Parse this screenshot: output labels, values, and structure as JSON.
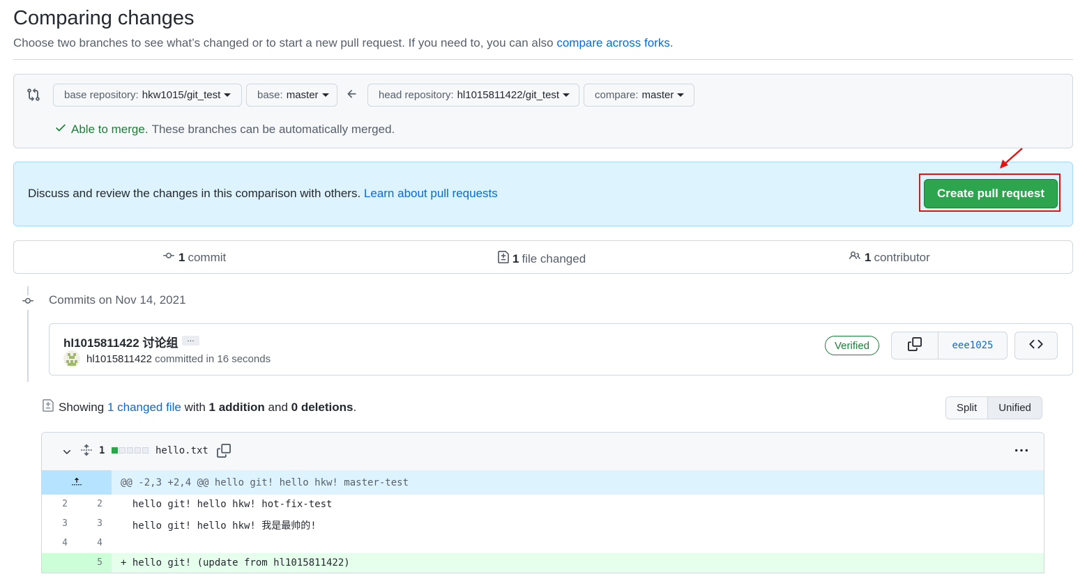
{
  "header": {
    "title": "Comparing changes",
    "subtitle": "Choose two branches to see what’s changed or to start a new pull request. If you need to, you can also ",
    "subtitle_link": "compare across forks",
    "subtitle_end": "."
  },
  "range": {
    "base_repo_label": "base repository:",
    "base_repo_value": "hkw1015/git_test",
    "base_label": "base:",
    "base_value": "master",
    "head_repo_label": "head repository:",
    "head_repo_value": "hl1015811422/git_test",
    "compare_label": "compare:",
    "compare_value": "master",
    "merge_ok": "Able to merge.",
    "merge_msg": "These branches can be automatically merged."
  },
  "discuss": {
    "text": "Discuss and review the changes in this comparison with others.",
    "link": "Learn about pull requests",
    "button": "Create pull request"
  },
  "summary": {
    "commits_count": "1",
    "commits_label": "commit",
    "files_count": "1",
    "files_label": "file changed",
    "contributors_count": "1",
    "contributors_label": "contributor"
  },
  "commits": {
    "date_heading": "Commits on Nov 14, 2021",
    "title": "hl1015811422 讨论组",
    "ellipsis": "…",
    "author": "hl1015811422",
    "meta": "committed in 16 seconds",
    "verified": "Verified",
    "sha": "eee1025"
  },
  "showing": {
    "prefix": "Showing",
    "changed_link": "1 changed file",
    "with": "with",
    "additions": "1 addition",
    "and": "and",
    "deletions": "0 deletions",
    "end": ".",
    "split": "Split",
    "unified": "Unified"
  },
  "file": {
    "change_count": "1",
    "name": "hello.txt",
    "hunk": "@@ -2,3 +2,4 @@ hello git! hello hkw! master-test",
    "lines": [
      {
        "old": "2",
        "new": "2",
        "code": "  hello git! hello hkw! hot-fix-test"
      },
      {
        "old": "3",
        "new": "3",
        "code": "  hello git! hello hkw! 我是最帅的!"
      },
      {
        "old": "4",
        "new": "4",
        "code": ""
      },
      {
        "old": "",
        "new": "5",
        "code": "+ hello git! (update from hl1015811422)"
      }
    ]
  },
  "colors": {
    "accent": "#0969da",
    "success": "#2da44e",
    "annotation_red": "#e5130f"
  }
}
